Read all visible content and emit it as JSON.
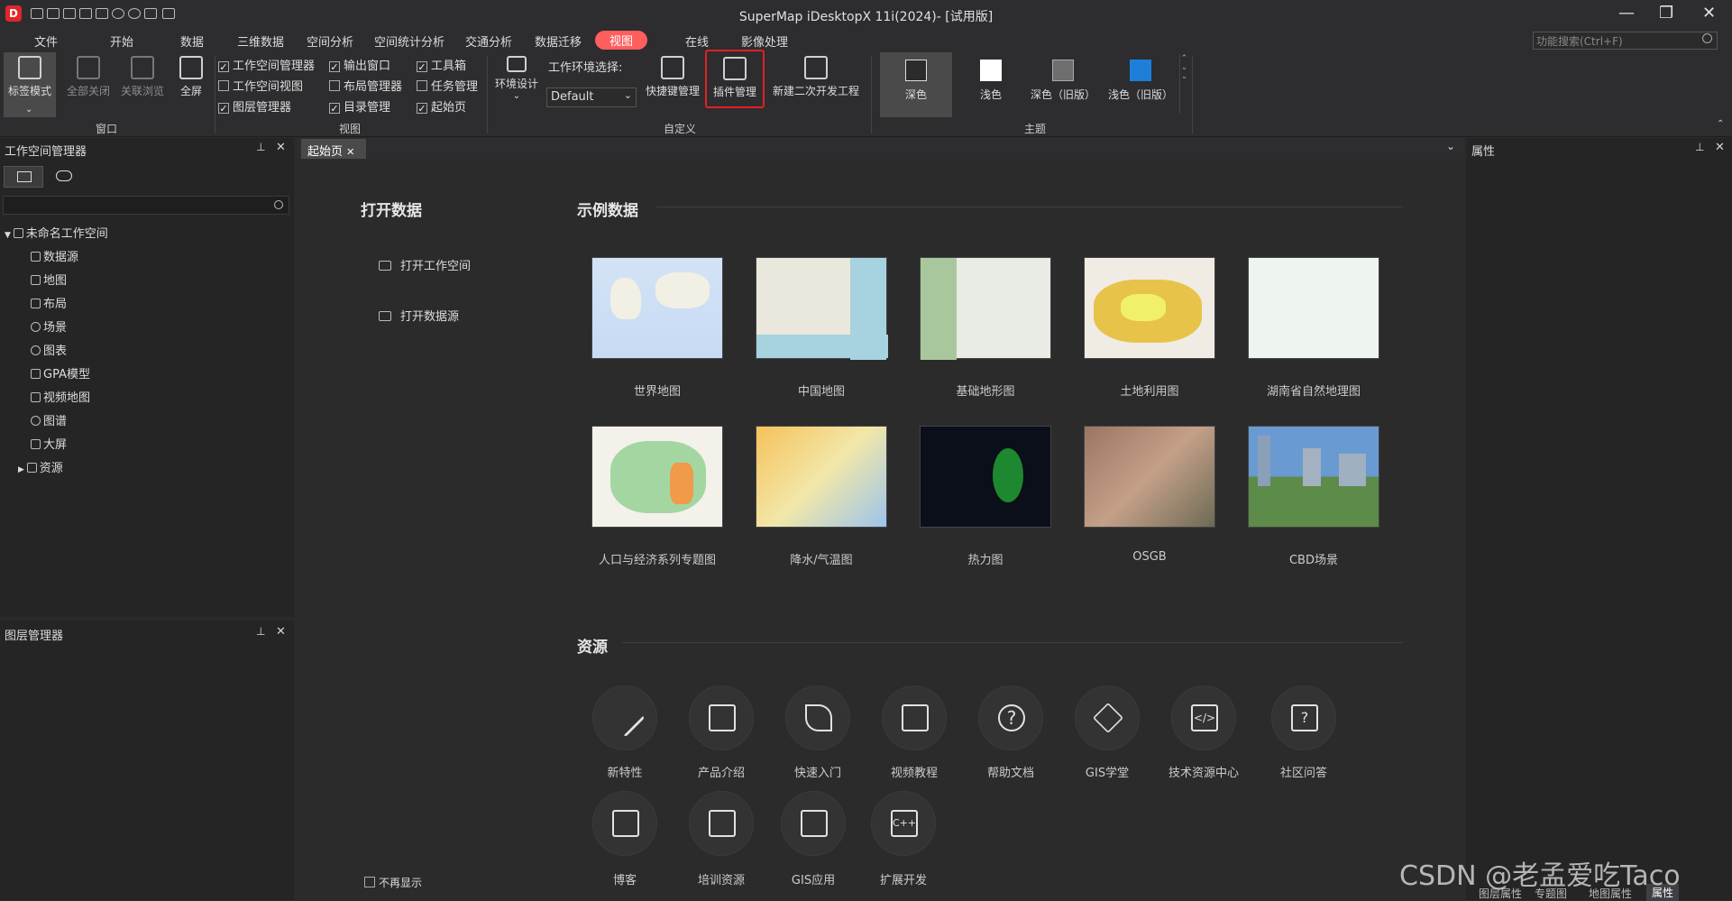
{
  "title": "SuperMap iDesktopX 11i(2024)- [试用版]",
  "menu": [
    "文件",
    "开始",
    "数据",
    "三维数据",
    "空间分析",
    "空间统计分析",
    "交通分析",
    "数据迁移",
    "视图",
    "在线",
    "影像处理"
  ],
  "search_placeholder": "功能搜索(Ctrl+F)",
  "ribbon": {
    "window": {
      "tab_mode": "标签模式",
      "close_all": "全部关闭",
      "linked_browse": "关联浏览",
      "fullscreen": "全屏",
      "group": "窗口"
    },
    "view": {
      "items": [
        {
          "label": "工作空间管理器",
          "checked": true
        },
        {
          "label": "工作空间视图",
          "checked": false
        },
        {
          "label": "图层管理器",
          "checked": true
        },
        {
          "label": "输出窗口",
          "checked": true
        },
        {
          "label": "布局管理器",
          "checked": false
        },
        {
          "label": "目录管理",
          "checked": true
        },
        {
          "label": "工具箱",
          "checked": true
        },
        {
          "label": "任务管理",
          "checked": false
        },
        {
          "label": "起始页",
          "checked": true
        }
      ],
      "group": "视图"
    },
    "custom": {
      "env_design": "环境设计",
      "env_select": "工作环境选择:",
      "env_value": "Default",
      "shortcut": "快捷键管理",
      "plugin": "插件管理",
      "new_project": "新建二次开发工程",
      "group": "自定义"
    },
    "theme": {
      "dark": "深色",
      "light": "浅色",
      "dark_old": "深色（旧版）",
      "light_old": "浅色（旧版）",
      "group": "主题"
    }
  },
  "workspace_panel": {
    "title": "工作空间管理器",
    "root": "未命名工作空间",
    "items": [
      "数据源",
      "地图",
      "布局",
      "场景",
      "图表",
      "GPA模型",
      "视频地图",
      "图谱",
      "大屏",
      "资源"
    ]
  },
  "layer_panel": {
    "title": "图层管理器"
  },
  "doc_tab": "起始页",
  "props_panel": {
    "title": "属性"
  },
  "start": {
    "open_data": "打开数据",
    "open_workspace": "打开工作空间",
    "open_datasource": "打开数据源",
    "sample_data": "示例数据",
    "samples": [
      "世界地图",
      "中国地图",
      "基础地形图",
      "土地利用图",
      "湖南省自然地理图",
      "人口与经济系列专题图",
      "降水/气温图",
      "热力图",
      "OSGB",
      "CBD场景"
    ],
    "resources": "资源",
    "res_items": [
      "新特性",
      "产品介绍",
      "快速入门",
      "视频教程",
      "帮助文档",
      "GIS学堂",
      "技术资源中心",
      "社区问答",
      "博客",
      "培训资源",
      "GIS应用",
      "扩展开发"
    ],
    "dont_show": "不再显示"
  },
  "bottom_tabs": [
    "图层属性",
    "专题图",
    "地图属性",
    "属性"
  ],
  "watermark": "CSDN @老孟爱吃Taco",
  "colors": {
    "accent": "#ff5e5e",
    "highlight_box": "#e02020",
    "theme_blue": "#1e7fd8"
  }
}
